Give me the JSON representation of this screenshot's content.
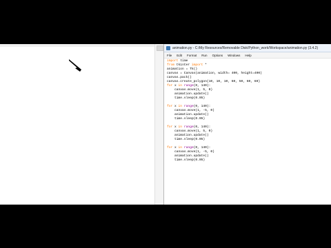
{
  "tk_window": {
    "shape": "black-arrow"
  },
  "idle": {
    "title": "animation.py - C:/My Resources/Removable Disk/Python_work/Workspace/animation.py (3.4.2)",
    "menu": [
      "File",
      "Edit",
      "Format",
      "Run",
      "Options",
      "Windows",
      "Help"
    ],
    "code_lines": [
      [
        [
          "kw",
          "import "
        ],
        [
          "",
          "time"
        ]
      ],
      [
        [
          "kw",
          "from "
        ],
        [
          "",
          "tkinter "
        ],
        [
          "kw",
          "import "
        ],
        [
          "",
          "*"
        ]
      ],
      [
        [
          "",
          "animation = Tk()"
        ]
      ],
      [
        [
          "",
          "canvas = Canvas(animation, width= 400, height=400)"
        ]
      ],
      [
        [
          "",
          "canvas.pack()"
        ]
      ],
      [
        [
          "",
          "canvas.create_polygon(10, 10, 10, 60, 50, 60, 60)"
        ]
      ],
      [
        [
          "kw",
          "for "
        ],
        [
          "",
          "x "
        ],
        [
          "kw",
          "in "
        ],
        [
          "bi",
          "range"
        ],
        [
          "",
          "(0, 140):"
        ]
      ],
      [
        [
          "",
          "    canvas.move(1, 5, 0)"
        ]
      ],
      [
        [
          "",
          "    animation.update()"
        ]
      ],
      [
        [
          "",
          "    time.sleep(0.05)"
        ]
      ],
      [
        [
          "",
          ""
        ]
      ],
      [
        [
          "kw",
          "for "
        ],
        [
          "",
          "x "
        ],
        [
          "kw",
          "in "
        ],
        [
          "bi",
          "range"
        ],
        [
          "",
          "(0, 140):"
        ]
      ],
      [
        [
          "",
          "    canvas.move(1, -5, 0)"
        ]
      ],
      [
        [
          "",
          "    animation.update()"
        ]
      ],
      [
        [
          "",
          "    time.sleep(0.05)"
        ]
      ],
      [
        [
          "",
          ""
        ]
      ],
      [
        [
          "kw",
          "for "
        ],
        [
          "",
          "x "
        ],
        [
          "kw",
          "in "
        ],
        [
          "bi",
          "range"
        ],
        [
          "",
          "(0, 140):"
        ]
      ],
      [
        [
          "",
          "    canvas.move(1, 5, 0)"
        ]
      ],
      [
        [
          "",
          "    animation.update()"
        ]
      ],
      [
        [
          "",
          "    time.sleep(0.05)"
        ]
      ],
      [
        [
          "",
          ""
        ]
      ],
      [
        [
          "kw",
          "for "
        ],
        [
          "",
          "x "
        ],
        [
          "kw",
          "in "
        ],
        [
          "bi",
          "range"
        ],
        [
          "",
          "(0, 140):"
        ]
      ],
      [
        [
          "",
          "    canvas.move(1, -5, 0)"
        ]
      ],
      [
        [
          "",
          "    animation.update()"
        ]
      ],
      [
        [
          "",
          "    time.sleep(0.05)"
        ]
      ]
    ]
  }
}
